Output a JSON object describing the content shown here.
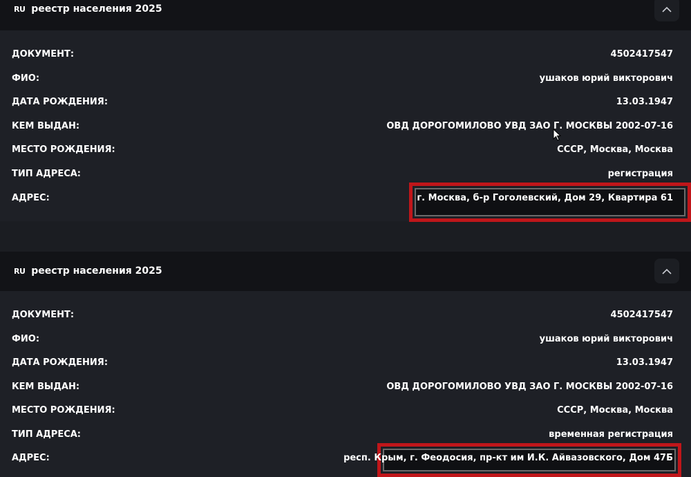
{
  "cards": [
    {
      "flag": "RU",
      "title": "реестр населения 2025",
      "rows": [
        {
          "label": "ДОКУМЕНТ:",
          "value": "4502417547"
        },
        {
          "label": "ФИО:",
          "value": "ушаков юрий викторович"
        },
        {
          "label": "ДАТА РОЖДЕНИЯ:",
          "value": "13.03.1947"
        },
        {
          "label": "КЕМ ВЫДАН:",
          "value": "ОВД ДОРОГОМИЛОВО УВД ЗАО Г. МОСКВЫ 2002-07-16"
        },
        {
          "label": "МЕСТО РОЖДЕНИЯ:",
          "value": "СССР, Москва, Москва"
        },
        {
          "label": "ТИП АДРЕСА:",
          "value": "регистрация"
        },
        {
          "label": "АДРЕС:",
          "value": "г. Москва, б-р Гоголевский, Дом 29, Квартира 61"
        }
      ]
    },
    {
      "flag": "RU",
      "title": "реестр населения 2025",
      "rows": [
        {
          "label": "ДОКУМЕНТ:",
          "value": "4502417547"
        },
        {
          "label": "ФИО:",
          "value": "ушаков юрий викторович"
        },
        {
          "label": "ДАТА РОЖДЕНИЯ:",
          "value": "13.03.1947"
        },
        {
          "label": "КЕМ ВЫДАН:",
          "value": "ОВД ДОРОГОМИЛОВО УВД ЗАО Г. МОСКВЫ 2002-07-16"
        },
        {
          "label": "МЕСТО РОЖДЕНИЯ:",
          "value": "СССР, Москва, Москва"
        },
        {
          "label": "ТИП АДРЕСА:",
          "value": "временная регистрация"
        },
        {
          "label": "АДРЕС:",
          "value": "респ. Крым, г. Феодосия, пр-кт им И.К. Айвазовского, Дом 47Б"
        }
      ]
    }
  ],
  "colors": {
    "background": "#1b1d22",
    "header": "#121317",
    "text": "#ffffff",
    "highlight": "#c0161a"
  },
  "icons": {
    "collapse": "chevron-up-icon",
    "pointer": "mouse-cursor-icon"
  }
}
